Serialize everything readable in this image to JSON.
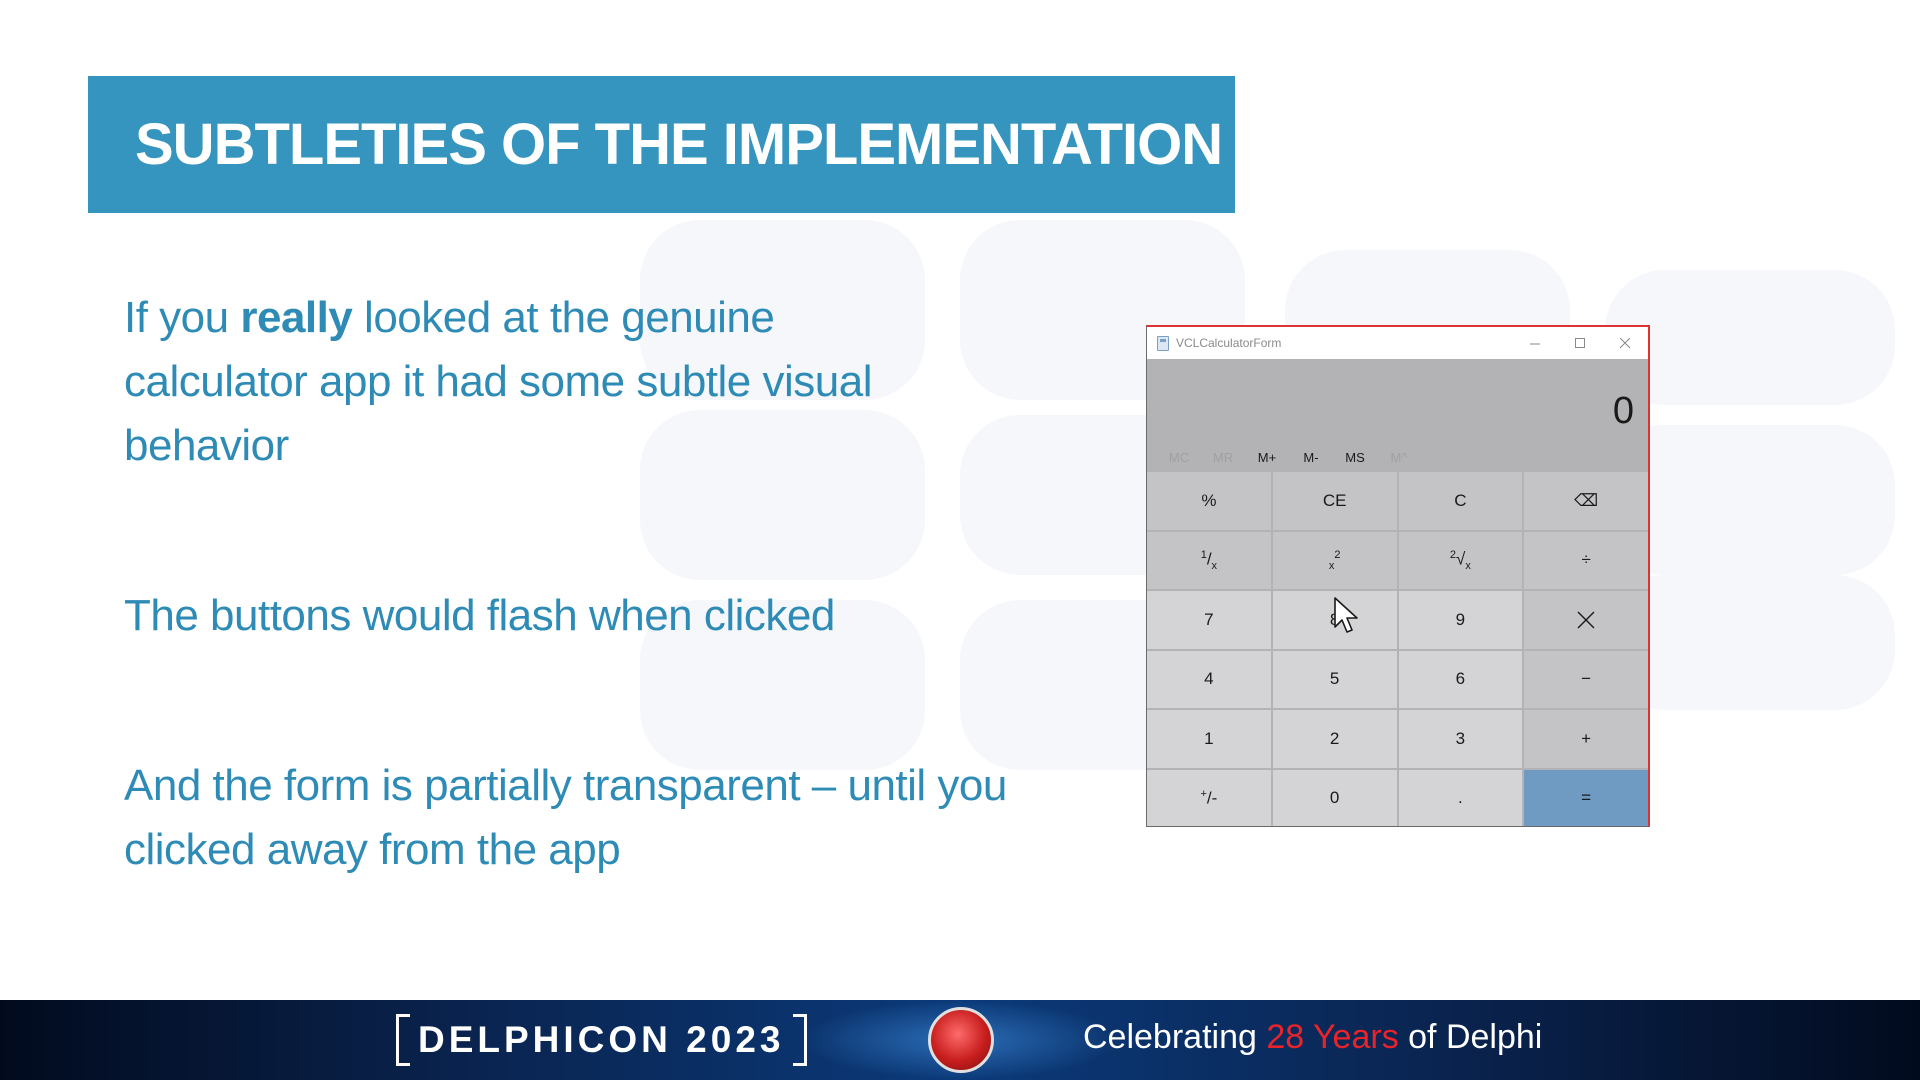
{
  "slide": {
    "title": "SUBTLETIES OF THE IMPLEMENTATION",
    "para1_pre": "If you ",
    "para1_bold": "really",
    "para1_post": " looked at the genuine calculator app it had some subtle visual behavior",
    "para2": "The buttons would flash when clicked",
    "para3": "And the form is partially transparent – until you clicked away from the app"
  },
  "calculator": {
    "window_title": "VCLCalculatorForm",
    "display": "0",
    "memory": [
      {
        "label": "MC",
        "enabled": false
      },
      {
        "label": "MR",
        "enabled": false
      },
      {
        "label": "M+",
        "enabled": true
      },
      {
        "label": "M-",
        "enabled": true
      },
      {
        "label": "MS",
        "enabled": true
      },
      {
        "label": "M^",
        "enabled": false
      }
    ],
    "keys": {
      "percent": "%",
      "ce": "CE",
      "c": "C",
      "backspace": "⌫",
      "reciprocal_num": "1",
      "reciprocal_den": "x",
      "square_base": "x",
      "square_exp": "2",
      "sqrt_root": "2",
      "sqrt_sym": "√",
      "sqrt_rad": "x",
      "divide": "÷",
      "seven": "7",
      "eight": "8",
      "nine": "9",
      "four": "4",
      "five": "5",
      "six": "6",
      "minus": "−",
      "one": "1",
      "two": "2",
      "three": "3",
      "plus": "+",
      "negate_plus": "+",
      "negate_minus": "/-",
      "zero": "0",
      "decimal": ".",
      "equals": "="
    },
    "colors": {
      "equals": "#6f9bc2",
      "background": "#b3b3b5"
    }
  },
  "footer": {
    "brand": "DELPHICON 2023",
    "tagline_pre": "Celebrating ",
    "tagline_accent": "28 Years",
    "tagline_post": " of Delphi",
    "accent_color": "#e8242a"
  },
  "colors": {
    "title_banner": "#3595be",
    "body_text": "#2e8bb6"
  }
}
